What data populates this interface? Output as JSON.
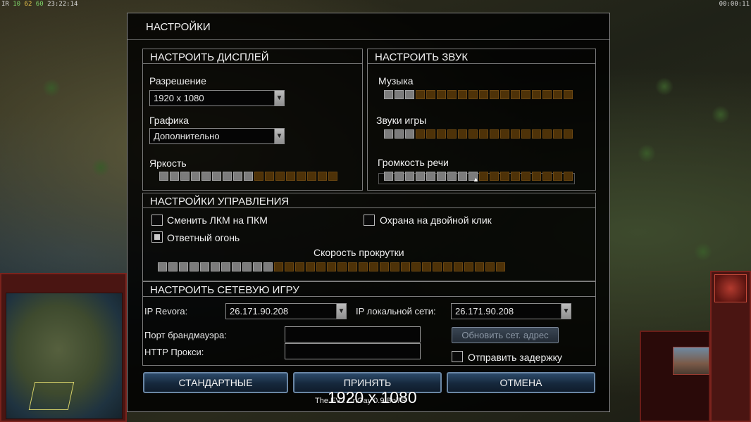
{
  "hud": {
    "left_prefix": "IR",
    "left_a": "10",
    "left_b": "62",
    "left_c": "60",
    "left_time": "23:22:14",
    "right_time": "00:00:11"
  },
  "dialog": {
    "title": "НАСТРОЙКИ"
  },
  "display": {
    "title": "НАСТРОИТЬ ДИСПЛЕЙ",
    "resolution_label": "Разрешение",
    "resolution_value": "1920 x 1080",
    "graphics_label": "Графика",
    "graphics_value": "Дополнительно",
    "brightness_label": "Яркость",
    "brightness_level": 9,
    "brightness_total": 17
  },
  "sound": {
    "title": "НАСТРОИТЬ ЗВУК",
    "music_label": "Музыка",
    "music_level": 3,
    "music_total": 18,
    "sfx_label": "Звуки игры",
    "sfx_level": 3,
    "sfx_total": 18,
    "speech_label": "Громкость речи",
    "speech_level": 9,
    "speech_total": 18
  },
  "controls": {
    "title": "НАСТРОЙКИ УПРАВЛЕНИЯ",
    "swap_mouse_label": "Сменить ЛКМ на ПКМ",
    "swap_mouse_checked": false,
    "double_click_guard_label": "Охрана на двойной клик",
    "double_click_guard_checked": false,
    "retaliation_label": "Ответный огонь",
    "retaliation_checked": true,
    "scroll_speed_label": "Скорость прокрутки",
    "scroll_level": 11,
    "scroll_total": 33
  },
  "network": {
    "title": "НАСТРОИТЬ СЕТЕВУЮ ИГРУ",
    "revora_ip_label": "IP Revora:",
    "revora_ip_value": "26.171.90.208",
    "lan_ip_label": "IP локальной сети:",
    "lan_ip_value": "26.171.90.208",
    "firewall_port_label": "Порт брандмауэра:",
    "firewall_port_value": "",
    "http_proxy_label": "HTTP Прокси:",
    "http_proxy_value": "",
    "refresh_label": "Обновить сет. адрес",
    "send_delay_label": "Отправить задержку",
    "send_delay_checked": false
  },
  "buttons": {
    "defaults": "СТАНДАРТНЫЕ",
    "accept": "ПРИНЯТЬ",
    "cancel": "ОТМЕНА"
  },
  "footer": {
    "version_text": "The EV2 CnGay 0.9 BoTS",
    "resolution_overlay": "1920 x 1080"
  }
}
